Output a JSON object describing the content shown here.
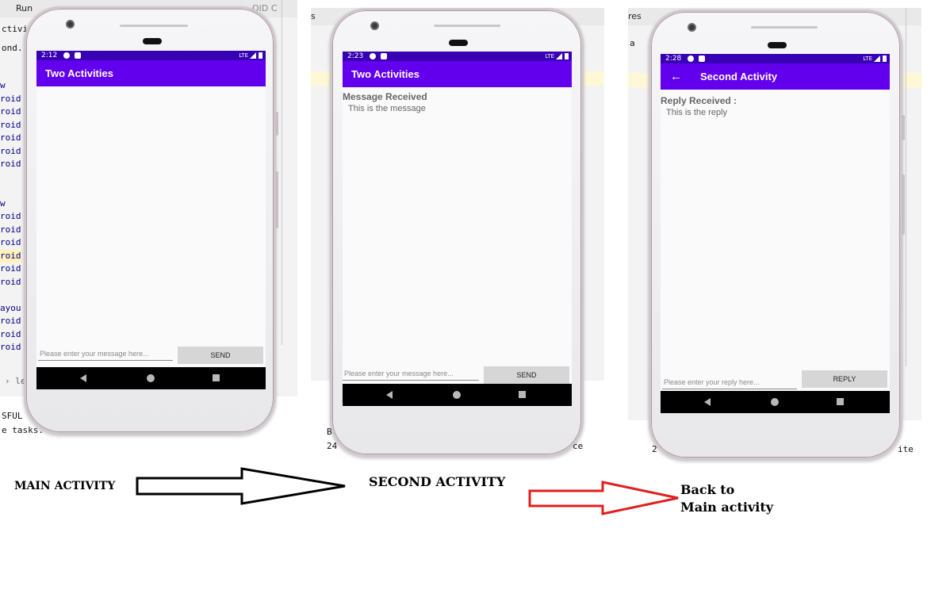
{
  "ide_left": {
    "topbar": "Run",
    "topbar_extra": "OID C",
    "side_label_1": "ctivit",
    "side_label_2": "ond.",
    "code_lines": [
      "w",
      "roid",
      "roid",
      "roid",
      "roid",
      "roid",
      "roid",
      "",
      "",
      "w",
      "roid",
      "roid",
      "roid",
      "roid",
      "roid",
      "roid",
      "",
      "ayou",
      "roid",
      "roid",
      "roid"
    ],
    "tab": "le",
    "build_1": "SFUL",
    "build_2": "e tasks."
  },
  "ide_mid": {
    "topbar": "s",
    "build_1": "B",
    "build_2": "24",
    "build_3": "ce"
  },
  "ide_right": {
    "topbar": "res",
    "side_1": "a",
    "build_2": "2",
    "build_3": "ite"
  },
  "phones": [
    {
      "time": "2:12",
      "network": "LTE",
      "appbar_title": "Two Activities",
      "input_placeholder": "Please enter your message here...",
      "button_label": "SEND"
    },
    {
      "time": "2:23",
      "network": "LTE",
      "appbar_title": "Two Activities",
      "header": "Message Received",
      "message": "This is the message",
      "input_placeholder": "Please enter your message here...",
      "button_label": "SEND"
    },
    {
      "time": "2:28",
      "network": "LTE",
      "appbar_title": "Second Activity",
      "back_glyph": "←",
      "header": "Reply Received :",
      "message": "This is the reply",
      "input_placeholder": "Please enter your reply here...",
      "button_label": "REPLY"
    }
  ],
  "captions": {
    "main": "MAIN ACTIVITY",
    "second": "SECOND ACTIVITY",
    "back_line1": "Back to",
    "back_line2": "Main activity"
  },
  "colors": {
    "status_bar": "#3700b3",
    "app_bar": "#6200ee",
    "arrow_black": "#000000",
    "arrow_red": "#e02020"
  }
}
